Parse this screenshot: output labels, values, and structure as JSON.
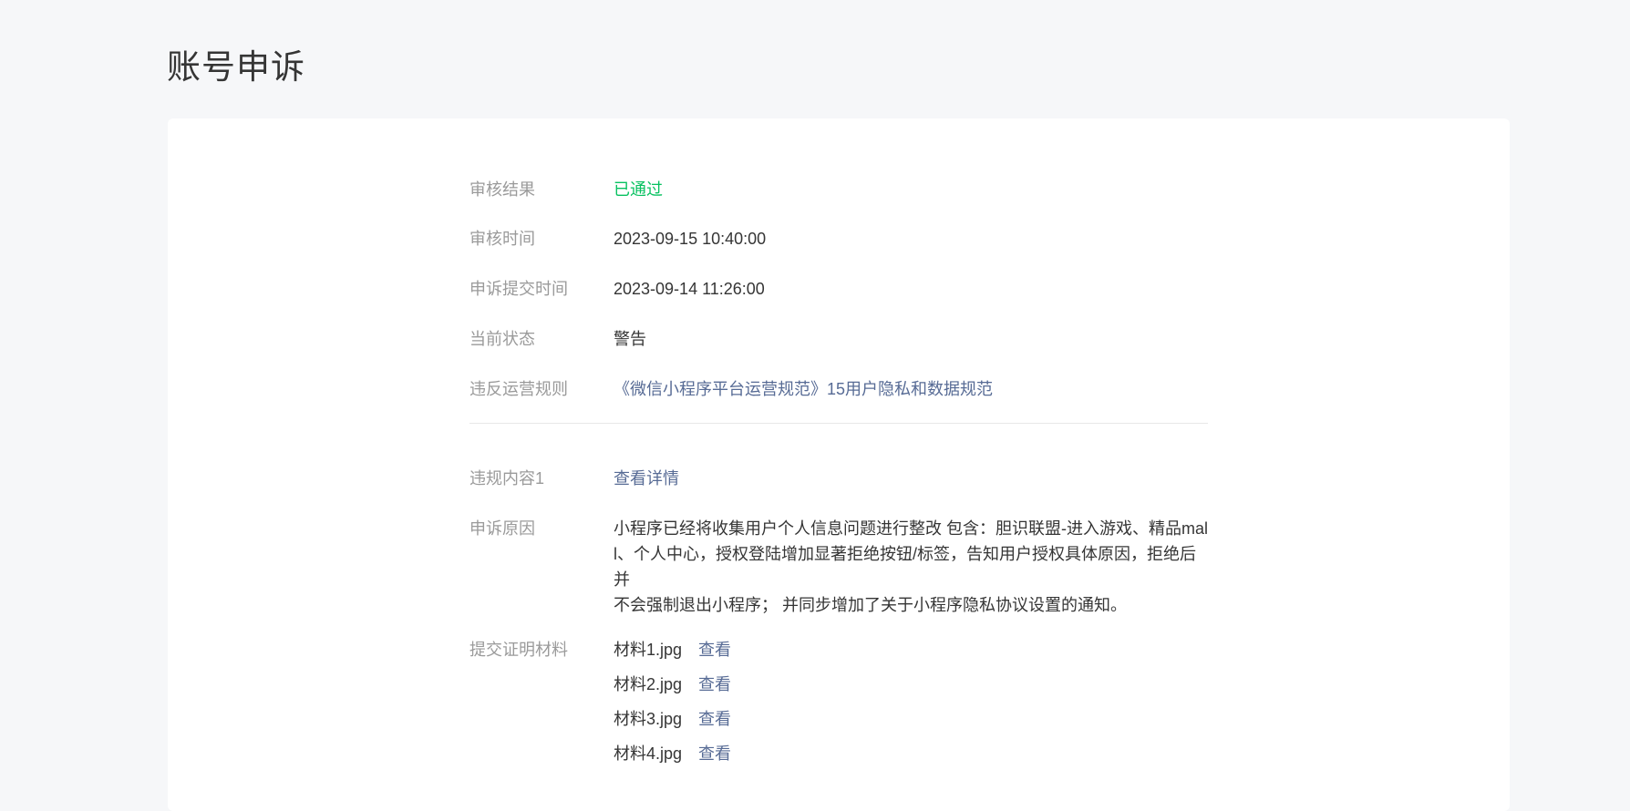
{
  "page": {
    "title": "账号申诉"
  },
  "colors": {
    "background": "#f6f7f9",
    "card": "#ffffff",
    "success": "#07c160",
    "link": "#576b95",
    "label": "#9a9a9a",
    "text": "#353535"
  },
  "details": {
    "review_result": {
      "label": "审核结果",
      "value": "已通过"
    },
    "review_time": {
      "label": "审核时间",
      "value": "2023-09-15 10:40:00"
    },
    "submit_time": {
      "label": "申诉提交时间",
      "value": "2023-09-14 11:26:00"
    },
    "current_status": {
      "label": "当前状态",
      "value": "警告"
    },
    "violated_rule": {
      "label": "违反运营规则",
      "value": "《微信小程序平台运营规范》15用户隐私和数据规范"
    }
  },
  "violation": {
    "content_1": {
      "label": "违规内容1",
      "link": "查看详情"
    },
    "reason": {
      "label": "申诉原因",
      "lines": [
        "小程序已经将收集用户个人信息问题进行整改 包含：胆识联盟-进入游戏、精品mal",
        "l、个人中心，授权登陆增加显著拒绝按钮/标签，告知用户授权具体原因，拒绝后并",
        "不会强制退出小程序；  并同步增加了关于小程序隐私协议设置的通知。"
      ]
    },
    "materials": {
      "label": "提交证明材料",
      "files": [
        {
          "name": "材料1.jpg",
          "action": "查看"
        },
        {
          "name": "材料2.jpg",
          "action": "查看"
        },
        {
          "name": "材料3.jpg",
          "action": "查看"
        },
        {
          "name": "材料4.jpg",
          "action": "查看"
        }
      ]
    }
  }
}
